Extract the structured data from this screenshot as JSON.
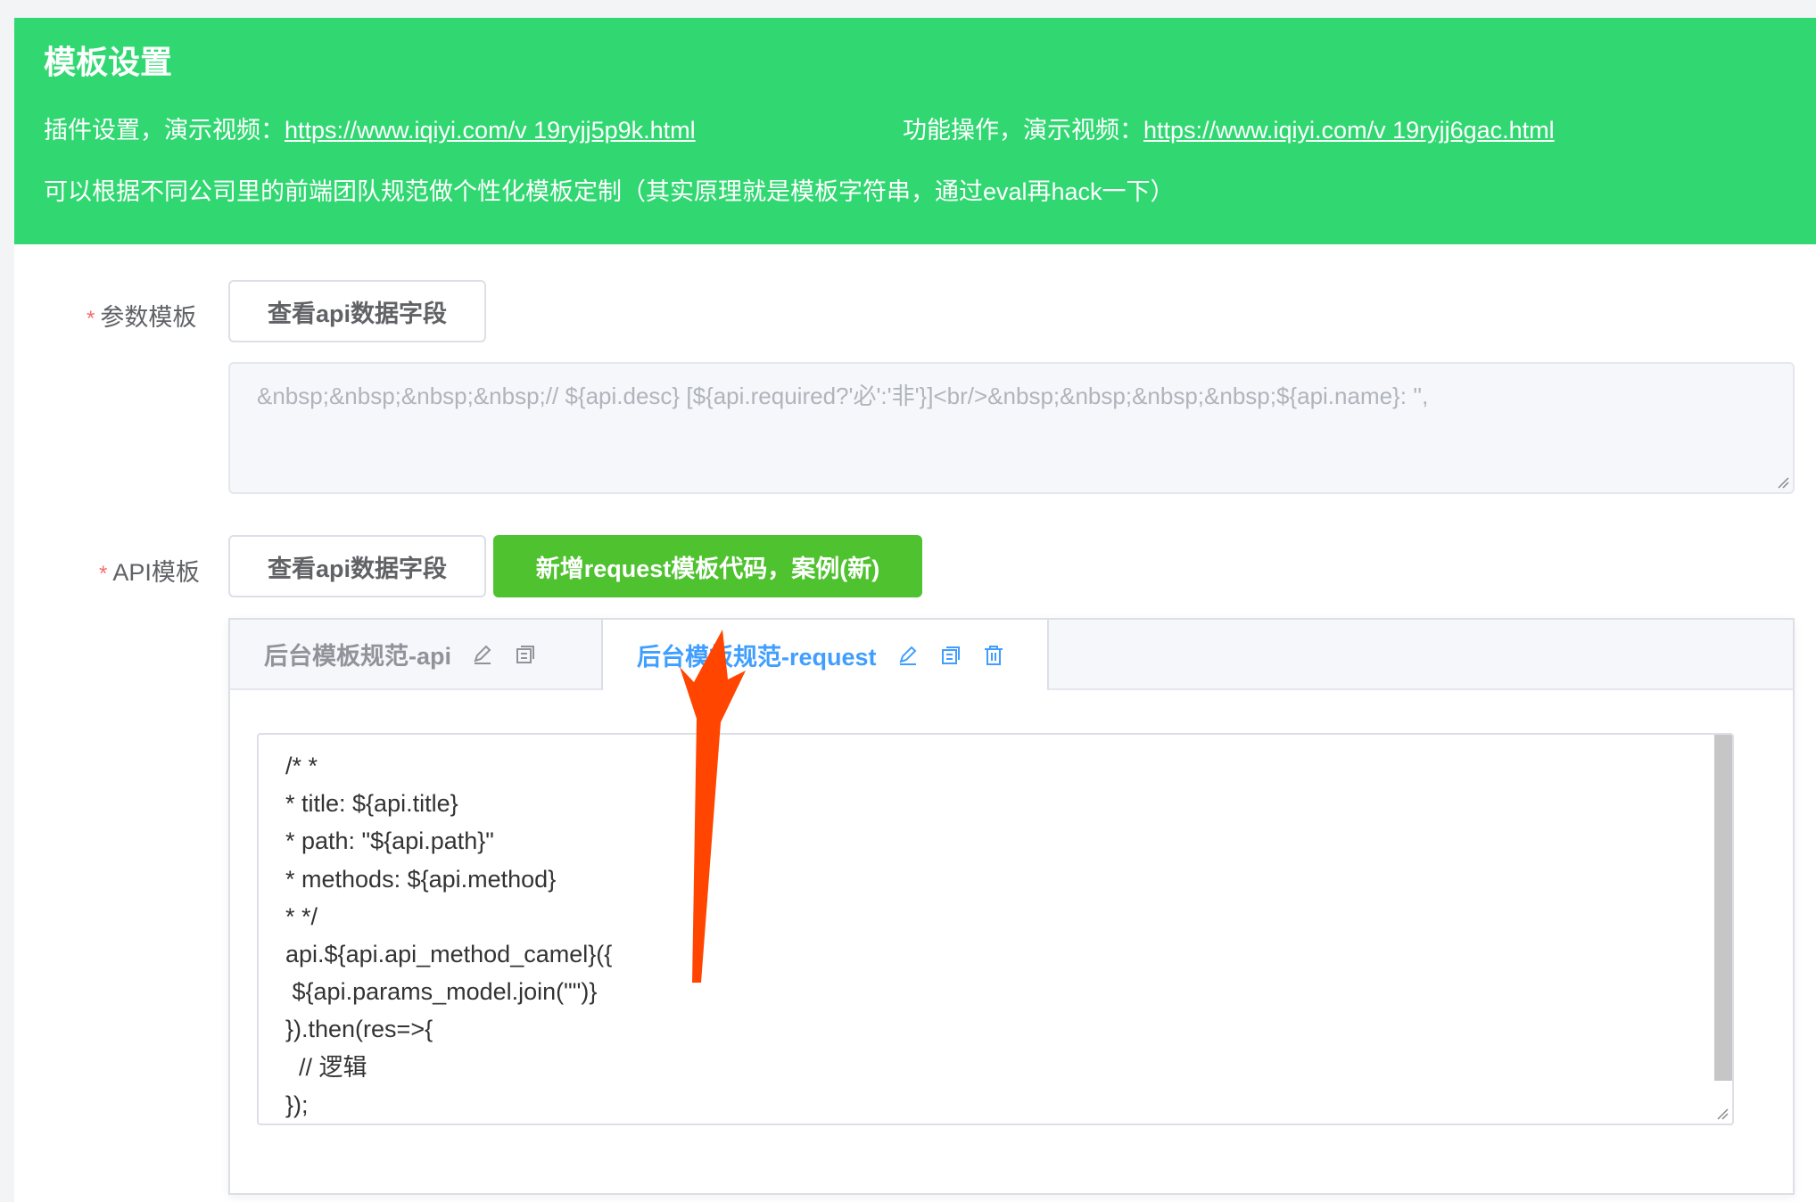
{
  "banner": {
    "title": "模板设置",
    "plugin_prefix": "插件设置，演示视频：",
    "plugin_link": "https://www.iqiyi.com/v 19ryjj5p9k.html",
    "feature_prefix": "功能操作，演示视频：",
    "feature_link": "https://www.iqiyi.com/v 19ryjj6gac.html",
    "description": "可以根据不同公司里的前端团队规范做个性化模板定制（其实原理就是模板字符串，通过eval再hack一下）"
  },
  "param_template": {
    "required_mark": "*",
    "label": "参数模板",
    "view_fields_button": "查看api数据字段",
    "value": "&nbsp;&nbsp;&nbsp;&nbsp;// ${api.desc} [${api.required?'必':'非'}]<br/>&nbsp;&nbsp;&nbsp;&nbsp;${api.name}: '',"
  },
  "api_template": {
    "required_mark": "*",
    "label": "API模板",
    "view_fields_button": "查看api数据字段",
    "add_button": "新增request模板代码，案例(新)",
    "tabs": [
      {
        "label": "后台模板规范-api",
        "active": false,
        "icons": [
          "edit-icon",
          "copy-icon"
        ]
      },
      {
        "label": "后台模板规范-request",
        "active": true,
        "icons": [
          "edit-icon",
          "copy-icon",
          "delete-icon"
        ]
      }
    ],
    "code_lines": [
      "/* *",
      "* title: ${api.title}",
      "* path: \"${api.path}\"",
      "* methods: ${api.method}",
      "* */",
      "api.${api.api_method_camel}({",
      " ${api.params_model.join(\"\")}",
      "}).then(res=>{",
      "  // 逻辑",
      "});"
    ]
  },
  "colors": {
    "banner_bg": "#31d872",
    "success_button": "#4fc22f",
    "active_tab": "#409eff",
    "required_mark": "#f56c6c",
    "annotation_arrow": "#ff4500"
  }
}
